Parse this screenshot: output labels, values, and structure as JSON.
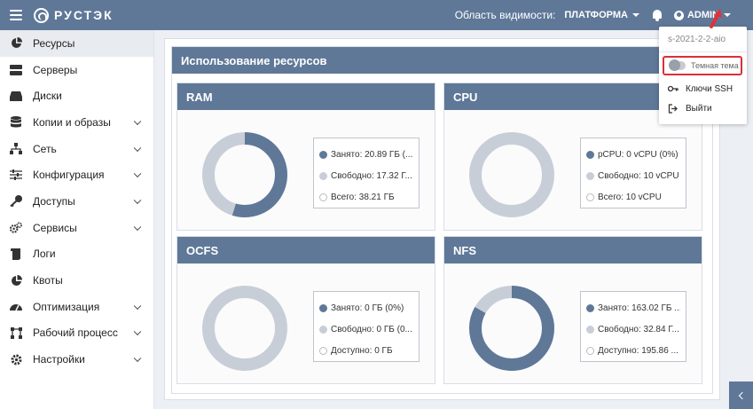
{
  "app": {
    "logo_text": "РУСТЭК"
  },
  "topbar": {
    "scope_label": "Область видимости:",
    "scope_value": "ПЛАТФОРМА",
    "user": "ADMIN"
  },
  "sidebar": {
    "items": [
      {
        "label": "Ресурсы",
        "icon": "pie-chart-icon",
        "active": true
      },
      {
        "label": "Серверы",
        "icon": "server-icon"
      },
      {
        "label": "Диски",
        "icon": "disk-icon"
      },
      {
        "label": "Копии и образы",
        "icon": "database-icon",
        "expandable": true
      },
      {
        "label": "Сеть",
        "icon": "network-icon",
        "expandable": true
      },
      {
        "label": "Конфигурация",
        "icon": "sliders-icon",
        "expandable": true
      },
      {
        "label": "Доступы",
        "icon": "key-icon",
        "expandable": true
      },
      {
        "label": "Сервисы",
        "icon": "gears-icon",
        "expandable": true
      },
      {
        "label": "Логи",
        "icon": "scroll-icon"
      },
      {
        "label": "Квоты",
        "icon": "pie-chart-icon"
      },
      {
        "label": "Оптимизация",
        "icon": "speedometer-icon",
        "expandable": true
      },
      {
        "label": "Рабочий процесс",
        "icon": "workflow-icon",
        "expandable": true
      },
      {
        "label": "Настройки",
        "icon": "gear-icon",
        "expandable": true
      }
    ]
  },
  "main": {
    "panel_title": "Использование ресурсов",
    "cards": [
      {
        "title": "RAM",
        "used_fraction": 0.547,
        "legend": [
          "Занято: 20.89 ГБ (...",
          "Свободно: 17.32 Г...",
          "Всего: 38.21 ГБ"
        ]
      },
      {
        "title": "CPU",
        "used_fraction": 0,
        "legend": [
          "pCPU: 0 vCPU (0%)",
          "Свободно: 10 vCPU",
          "Всего: 10 vCPU"
        ]
      },
      {
        "title": "OCFS",
        "used_fraction": 0,
        "legend": [
          "Занято: 0 ГБ (0%)",
          "Свободно: 0 ГБ (0...",
          "Доступно: 0 ГБ"
        ]
      },
      {
        "title": "NFS",
        "used_fraction": 0.832,
        "legend": [
          "Занято: 163.02 ГБ ...",
          "Свободно: 32.84 Г...",
          "Доступно: 195.86 ..."
        ]
      }
    ]
  },
  "dropdown": {
    "host": "s-2021-2-2-aio",
    "dark_theme_label": "Темная тема",
    "ssh_keys": "Ключи SSH",
    "logout": "Выйти"
  },
  "colors": {
    "accent": "#5f7898",
    "used": "#5f7898",
    "free": "#c8ced8",
    "highlight": "#d9303a"
  }
}
